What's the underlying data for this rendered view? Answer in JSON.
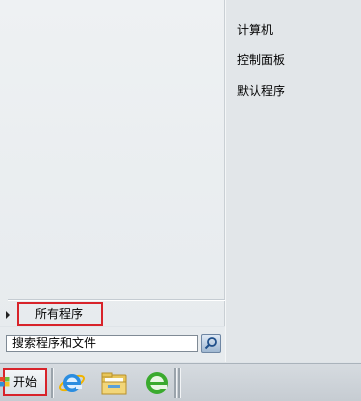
{
  "start_menu": {
    "right_items": [
      {
        "label": "计算机"
      },
      {
        "label": "控制面板"
      },
      {
        "label": "默认程序"
      }
    ],
    "all_programs_label": "所有程序",
    "search": {
      "placeholder": "搜索程序和文件"
    }
  },
  "taskbar": {
    "start_label": "开始",
    "pinned": [
      {
        "icon": "internet-explorer-icon"
      },
      {
        "icon": "folder-icon"
      },
      {
        "icon": "ie-refresh-icon"
      }
    ]
  },
  "colors": {
    "highlight_border": "#d8232a",
    "menu_bg": "#e7ebee",
    "taskbar_bg": "#cdd3d8"
  }
}
